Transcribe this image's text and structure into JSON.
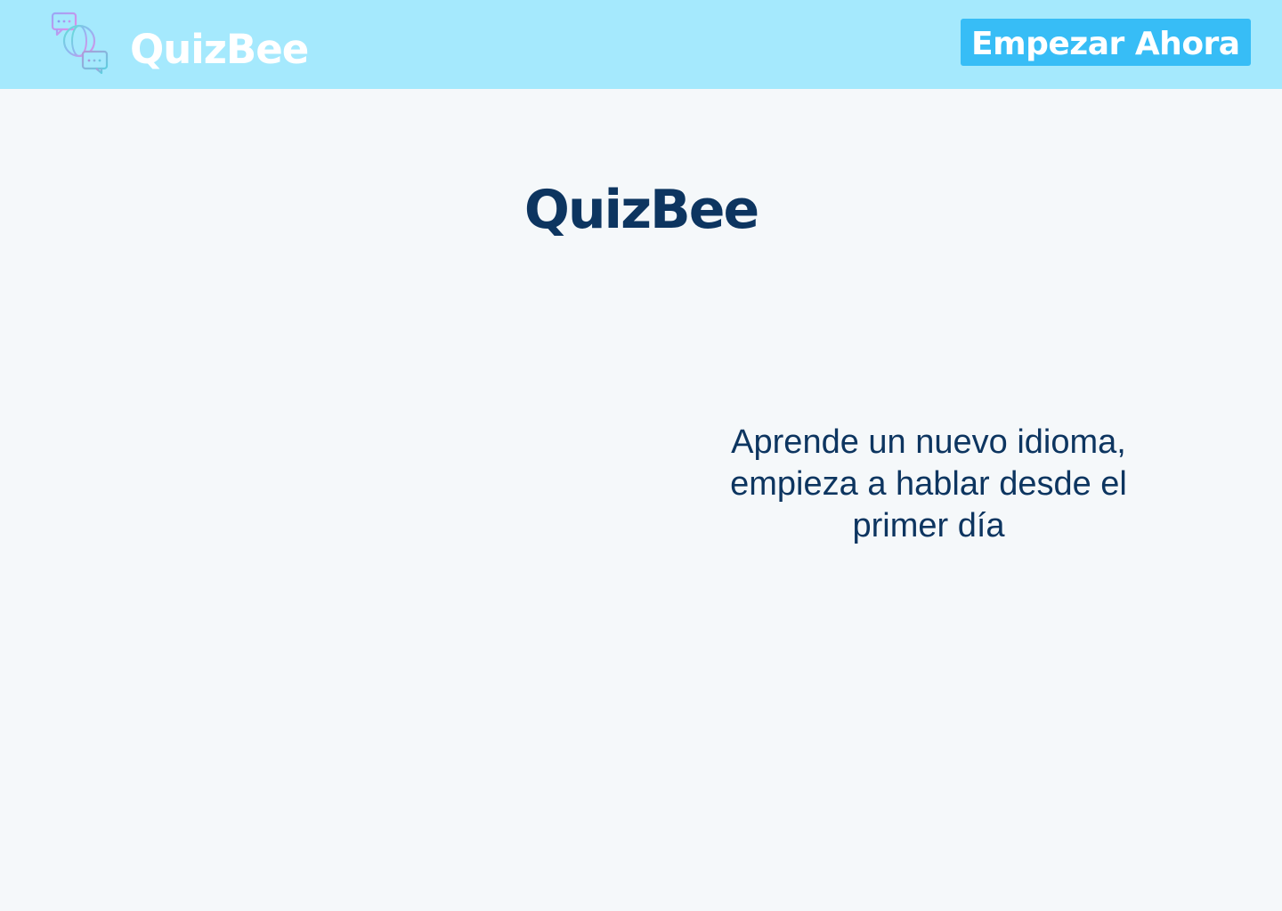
{
  "navbar": {
    "brand": "QuizBee",
    "logo_icon": "chat-globe-icon",
    "cta_label": "Empezar Ahora"
  },
  "hero": {
    "title": "QuizBee",
    "tagline": "Aprende un nuevo idioma, empieza a hablar desde el primer día"
  },
  "colors": {
    "navbar_bg": "#a5e9fd",
    "cta_bg": "#37bdf6",
    "page_bg": "#f5f8fa",
    "text_dark": "#0d3560",
    "white": "#ffffff"
  }
}
